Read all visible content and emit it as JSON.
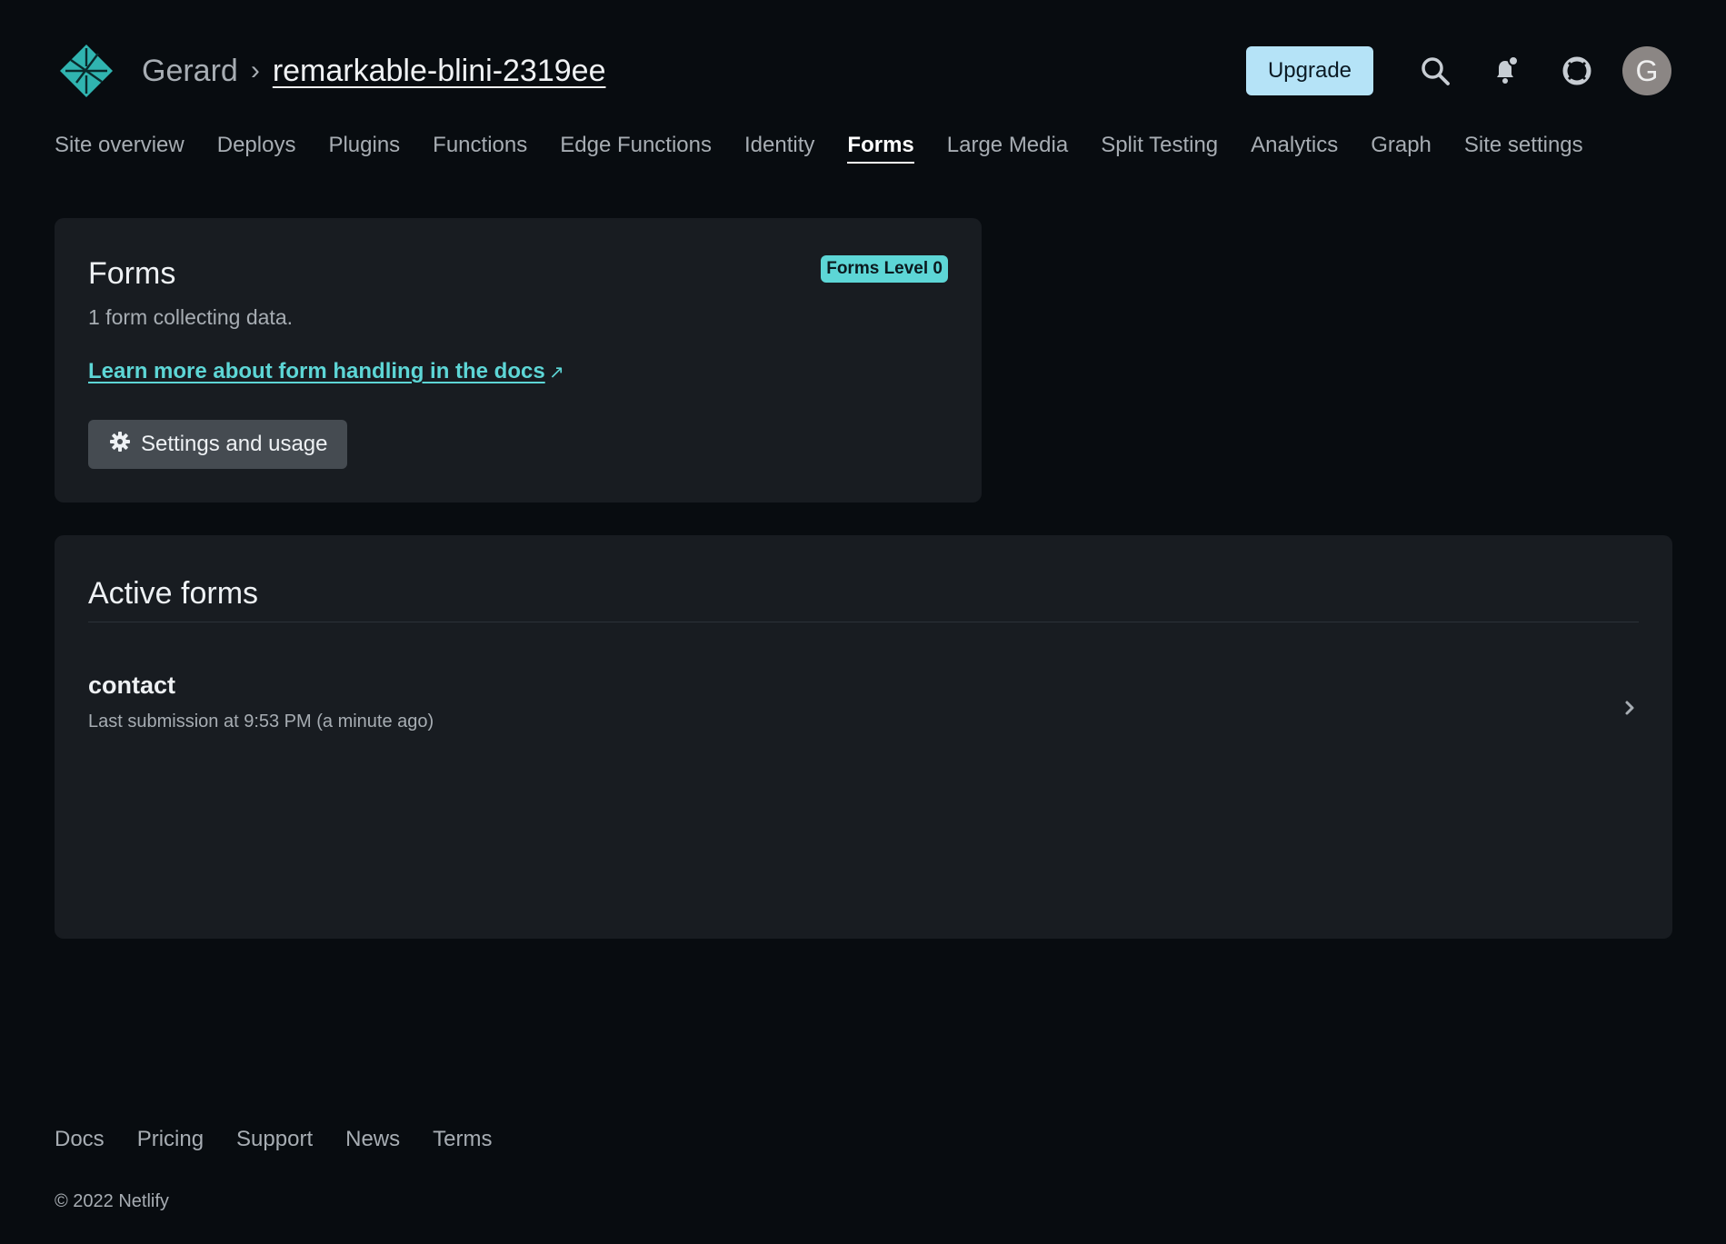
{
  "header": {
    "team": "Gerard",
    "separator": "›",
    "site": "remarkable-blini-2319ee",
    "upgrade_label": "Upgrade",
    "avatar_initial": "G"
  },
  "nav": {
    "items": [
      "Site overview",
      "Deploys",
      "Plugins",
      "Functions",
      "Edge Functions",
      "Identity",
      "Forms",
      "Large Media",
      "Split Testing",
      "Analytics",
      "Graph",
      "Site settings"
    ],
    "active": "Forms"
  },
  "forms_card": {
    "title": "Forms",
    "badge": "Forms Level 0",
    "subtitle": "1 form collecting data.",
    "docs_link": "Learn more about form handling in the docs",
    "external_arrow": "↗",
    "settings_label": "Settings and usage"
  },
  "active_forms": {
    "title": "Active forms",
    "forms": [
      {
        "name": "contact",
        "meta": "Last submission at 9:53 PM (a minute ago)"
      }
    ]
  },
  "footer": {
    "links": [
      "Docs",
      "Pricing",
      "Support",
      "News",
      "Terms"
    ],
    "copyright": "© 2022 Netlify"
  },
  "colors": {
    "background": "#080c10",
    "card": "#181c21",
    "accent": "#5dd6d6",
    "upgrade": "#b5e3f7"
  },
  "icons": [
    "netlify-logo-icon",
    "chevron-right-icon",
    "search-icon",
    "bell-icon",
    "lifebuoy-icon",
    "gear-icon",
    "external-link-icon"
  ]
}
